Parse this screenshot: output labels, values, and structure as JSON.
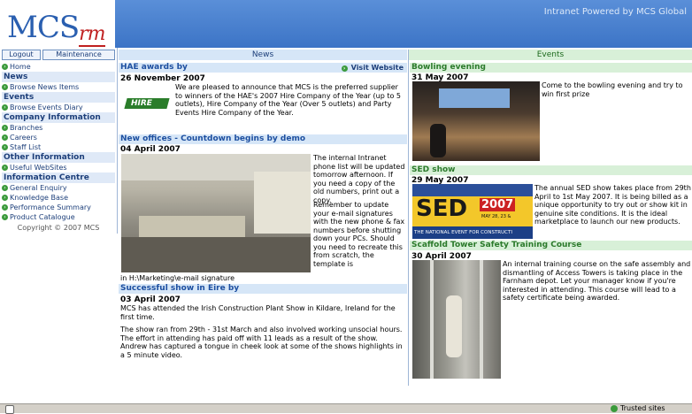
{
  "header": {
    "logo_text": "MCS",
    "logo_suffix": "rm",
    "banner_text": "Intranet Powered by MCS Global"
  },
  "sidebar": {
    "logout_label": "Logout",
    "maintenance_label": "Maintenance",
    "home": "Home",
    "sections": [
      {
        "heading": "News",
        "items": [
          "Browse News Items"
        ]
      },
      {
        "heading": "Events",
        "items": [
          "Browse Events Diary"
        ]
      },
      {
        "heading": "Company Information",
        "items": [
          "Branches",
          "Careers",
          "Staff List"
        ]
      },
      {
        "heading": "Other Information",
        "items": [
          "Useful WebSites"
        ]
      },
      {
        "heading": "Information Centre",
        "items": [
          "General Enquiry",
          "Knowledge Base",
          "Performance Summary",
          "Product Catalogue"
        ]
      }
    ],
    "copyright": "Copyright © 2007 MCS"
  },
  "news": {
    "column_title": "News",
    "articles": [
      {
        "title": "HAE awards by",
        "link": "Visit Website",
        "date": "26 November 2007",
        "body": "We are pleased to announce that MCS is the preferred supplier to winners of the HAE's 2007 Hire Company of the Year (up to 5 outlets), Hire Company of the Year (Over 5 outlets) and Party Events Hire Company of the Year.",
        "image_text": "HIRE"
      },
      {
        "title": "New offices - Countdown begins by demo",
        "date": "04 April 2007",
        "body": "The internal Intranet phone list will be updated tomorrow afternoon. If you need a copy of the old numbers, print out a copy.",
        "body2": "Remember to update your e-mail signatures with the new phone & fax numbers before shutting down your PCs. Should you need to recreate this from scratch, the template is",
        "body3": "in H:\\Marketing\\e-mail signature"
      },
      {
        "title": "Successful show in Eire by",
        "date": "03 April 2007",
        "body": "MCS has attended the Irish Construction Plant Show in Kildare, Ireland for the first time.",
        "body2": "The show ran from 29th - 31st March and also involved working unsocial hours. The effort in attending has paid off with 11 leads as a result of the show. Andrew has captured a tongue in cheek look at some of the shows highlights in a 5 minute video."
      }
    ]
  },
  "events": {
    "column_title": "Events",
    "items": [
      {
        "title": "Bowling evening",
        "date": "31 May 2007",
        "body": "Come to the bowling evening and try to win first prize"
      },
      {
        "title": "SED show",
        "date": "29 May 2007",
        "body": "The annual SED show takes place from 29th April to 1st May 2007. It is being billed as a unique opportunity to try out or show kit in genuine site conditions. It is the ideal marketplace to launch our new products.",
        "image_big": "SED",
        "image_year": "2007",
        "image_dates": "MAY 28, 23 &",
        "image_caption": "THE NATIONAL EVENT FOR CONSTRUCTI"
      },
      {
        "title": "Scaffold Tower Safety Training Course",
        "date": "30 April 2007",
        "body": "An internal training course on the safe assembly and dismantling of Access Towers is taking place in the Farnham depot. Let your manager know if you're interested in attending. This course will lead to a safety certificate being awarded."
      }
    ]
  },
  "statusbar": {
    "zone": "Trusted sites"
  },
  "colors": {
    "banner": "#3c74c6",
    "news_header": "#d6e6f7",
    "events_header": "#d8f0d8",
    "nav_icon": "#3b9a3b"
  }
}
